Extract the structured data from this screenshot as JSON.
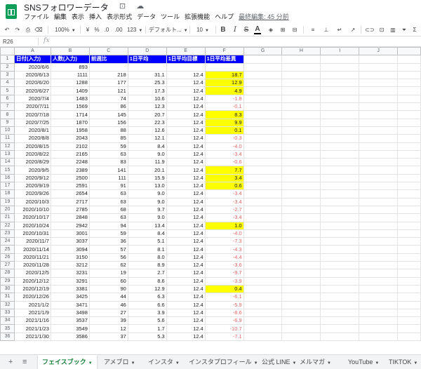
{
  "app": {
    "title": "SNSフォロワーデータ",
    "title_icons": "☆ ⊡ ☁",
    "menu": [
      "ファイル",
      "編集",
      "表示",
      "挿入",
      "表示形式",
      "データ",
      "ツール",
      "拡張機能",
      "ヘルプ"
    ],
    "last_edit": "最終編集: 45 分前"
  },
  "toolbar": {
    "undo": "↶",
    "redo": "↷",
    "print": "⎙",
    "paint": "⌫",
    "zoom": "100%",
    "currency": "¥",
    "percent": "%",
    "dec_less": ".0",
    "dec_more": ".00",
    "format": "123",
    "font": "デフォルト...",
    "font_size": "10",
    "bold": "B",
    "italic": "I",
    "strike": "S",
    "text_color": "A",
    "fill": "◈",
    "borders": "⊞",
    "merge": "⊟",
    "align": "≡",
    "valign": "⊥",
    "wrap": "↵",
    "rotate": "↗",
    "link": "⊂⊃",
    "comment": "⊡",
    "chart": "▥",
    "filter": "⏷",
    "sum": "Σ"
  },
  "formula_bar": {
    "cell_ref": "R26",
    "fx": "fx"
  },
  "columns": [
    "A",
    "B",
    "C",
    "D",
    "E",
    "F",
    "G",
    "H",
    "I",
    "J"
  ],
  "header_row": [
    "日付(入力)",
    "人数(入力)",
    "前週比",
    "1日平均",
    "1日平均目標",
    "1日平均差異"
  ],
  "rows": [
    [
      "2020/6/6",
      "893",
      "",
      "",
      "",
      "",
      false
    ],
    [
      "2020/6/13",
      "1111",
      "218",
      "31.1",
      "12.4",
      "18.7",
      true
    ],
    [
      "2020/6/20",
      "1288",
      "177",
      "25.3",
      "12.4",
      "12.9",
      true
    ],
    [
      "2020/6/27",
      "1409",
      "121",
      "17.3",
      "12.4",
      "4.9",
      true
    ],
    [
      "2020/7/4",
      "1483",
      "74",
      "10.6",
      "12.4",
      "-1.8",
      false
    ],
    [
      "2020/7/11",
      "1569",
      "86",
      "12.3",
      "12.4",
      "-0.1",
      false
    ],
    [
      "2020/7/18",
      "1714",
      "145",
      "20.7",
      "12.4",
      "8.3",
      true
    ],
    [
      "2020/7/25",
      "1870",
      "156",
      "22.3",
      "12.4",
      "9.9",
      true
    ],
    [
      "2020/8/1",
      "1958",
      "88",
      "12.6",
      "12.4",
      "0.1",
      true
    ],
    [
      "2020/8/8",
      "2043",
      "85",
      "12.1",
      "12.4",
      "-0.3",
      false
    ],
    [
      "2020/8/15",
      "2102",
      "59",
      "8.4",
      "12.4",
      "-4.0",
      false
    ],
    [
      "2020/8/22",
      "2165",
      "63",
      "9.0",
      "12.4",
      "-3.4",
      false
    ],
    [
      "2020/8/29",
      "2248",
      "83",
      "11.9",
      "12.4",
      "-0.6",
      false
    ],
    [
      "2020/9/5",
      "2389",
      "141",
      "20.1",
      "12.4",
      "7.7",
      true
    ],
    [
      "2020/9/12",
      "2500",
      "111",
      "15.9",
      "12.4",
      "3.4",
      true
    ],
    [
      "2020/9/19",
      "2591",
      "91",
      "13.0",
      "12.4",
      "0.6",
      true
    ],
    [
      "2020/9/26",
      "2654",
      "63",
      "9.0",
      "12.4",
      "-3.4",
      false
    ],
    [
      "2020/10/3",
      "2717",
      "63",
      "9.0",
      "12.4",
      "-3.4",
      false
    ],
    [
      "2020/10/10",
      "2785",
      "68",
      "9.7",
      "12.4",
      "-2.7",
      false
    ],
    [
      "2020/10/17",
      "2848",
      "63",
      "9.0",
      "12.4",
      "-3.4",
      false
    ],
    [
      "2020/10/24",
      "2942",
      "94",
      "13.4",
      "12.4",
      "1.0",
      true
    ],
    [
      "2020/10/31",
      "3001",
      "59",
      "8.4",
      "12.4",
      "-4.0",
      false
    ],
    [
      "2020/11/7",
      "3037",
      "36",
      "5.1",
      "12.4",
      "-7.3",
      false
    ],
    [
      "2020/11/14",
      "3094",
      "57",
      "8.1",
      "12.4",
      "-4.3",
      false
    ],
    [
      "2020/11/21",
      "3150",
      "56",
      "8.0",
      "12.4",
      "-4.4",
      false
    ],
    [
      "2020/11/28",
      "3212",
      "62",
      "8.9",
      "12.4",
      "-3.6",
      false
    ],
    [
      "2020/12/5",
      "3231",
      "19",
      "2.7",
      "12.4",
      "-9.7",
      false
    ],
    [
      "2020/12/12",
      "3291",
      "60",
      "8.6",
      "12.4",
      "-3.9",
      false
    ],
    [
      "2020/12/19",
      "3381",
      "90",
      "12.9",
      "12.4",
      "0.4",
      true
    ],
    [
      "2020/12/26",
      "3425",
      "44",
      "6.3",
      "12.4",
      "-6.1",
      false
    ],
    [
      "2021/1/2",
      "3471",
      "46",
      "6.6",
      "12.4",
      "-5.9",
      false
    ],
    [
      "2021/1/9",
      "3498",
      "27",
      "3.9",
      "12.4",
      "-8.6",
      false
    ],
    [
      "2021/1/16",
      "3537",
      "39",
      "5.6",
      "12.4",
      "-6.9",
      false
    ],
    [
      "2021/1/23",
      "3549",
      "12",
      "1.7",
      "12.4",
      "-10.7",
      false
    ],
    [
      "2021/1/30",
      "3586",
      "37",
      "5.3",
      "12.4",
      "-7.1",
      false
    ]
  ],
  "colors": {
    "header_bg": "#0000ff",
    "highlight": "#ffff00",
    "negative": "#e06666",
    "active_tab": "#188038"
  },
  "sheet_tabs": {
    "add": "+",
    "list": "≡",
    "tabs": [
      "フェイスブック",
      "アメブロ",
      "インスタ",
      "インスタプロフィール",
      "公式 LINE",
      "メルマガ",
      "YouTube",
      "TIKTOK"
    ],
    "active_index": 0
  }
}
